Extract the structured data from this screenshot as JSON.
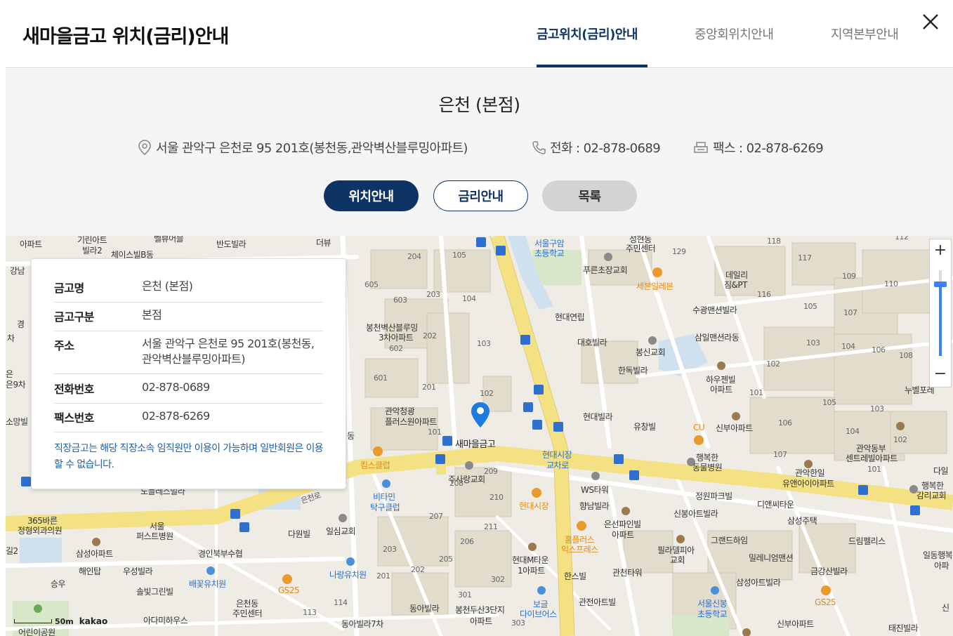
{
  "header": {
    "title": "새마을금고 위치(금리)안내",
    "tabs": [
      {
        "label": "금고위치(금리)안내",
        "active": true
      },
      {
        "label": "중앙회위치안내",
        "active": false
      },
      {
        "label": "지역본부안내",
        "active": false
      }
    ],
    "close_icon": "close-icon"
  },
  "branch": {
    "name": "은천 (본점)",
    "address": "서울 관악구 은천로 95 201호(봉천동,관악벽산블루밍아파트)",
    "phone": "전화 : 02-878-0689",
    "fax": "팩스 : 02-878-6269"
  },
  "buttons": {
    "location": "위치안내",
    "rate": "금리안내",
    "list": "목록"
  },
  "colors": {
    "brand_navy": "#0e3465",
    "note_blue": "#1f5fa8",
    "road_yellow": "#f7e98d",
    "map_bg": "#efece6"
  },
  "info_card": {
    "rows": [
      {
        "key": "금고명",
        "value": "은천 (본점)"
      },
      {
        "key": "금고구분",
        "value": "본점"
      },
      {
        "key": "주소",
        "value": "서울 관악구 은천로 95 201호(봉천동,관악벽산블루밍아파트)"
      },
      {
        "key": "전화번호",
        "value": "02-878-0689"
      },
      {
        "key": "팩스번호",
        "value": "02-878-6269"
      }
    ],
    "note": "직장금고는 해당 직장소속 임직원만 이용이 가능하며 일반회원은 이용 할 수 없습니다."
  },
  "map": {
    "zoom_in": "+",
    "zoom_out": "−",
    "scale": "50m",
    "provider": "kakao",
    "marker_label": "새마을금고",
    "labels": [
      {
        "t": "기린아트",
        "c": ""
      },
      {
        "t": "빌라2",
        "c": ""
      },
      {
        "t": "아파트",
        "c": ""
      },
      {
        "t": "벨뷰어블",
        "c": ""
      },
      {
        "t": "반도빌라",
        "c": ""
      },
      {
        "t": "더뷰",
        "c": ""
      },
      {
        "t": "체이스빌B동",
        "c": ""
      },
      {
        "t": "강남",
        "c": ""
      },
      {
        "t": "경",
        "c": ""
      },
      {
        "t": "차",
        "c": ""
      },
      {
        "t": "은",
        "c": ""
      },
      {
        "t": "은9차",
        "c": ""
      },
      {
        "t": "소망빌",
        "c": ""
      },
      {
        "t": "서울구암",
        "c": "blue"
      },
      {
        "t": "초등학교",
        "c": "blue"
      },
      {
        "t": "성현동",
        "c": ""
      },
      {
        "t": "주민센터",
        "c": ""
      },
      {
        "t": "푸른초장교회",
        "c": ""
      },
      {
        "t": "세븐일레븐",
        "c": "orange"
      },
      {
        "t": "현대연립",
        "c": ""
      },
      {
        "t": "대호빌라",
        "c": ""
      },
      {
        "t": "봉신교회",
        "c": ""
      },
      {
        "t": "한독빌라",
        "c": ""
      },
      {
        "t": "수광맨션빌라",
        "c": ""
      },
      {
        "t": "삼일맨션라동",
        "c": ""
      },
      {
        "t": "하우젠빌",
        "c": ""
      },
      {
        "t": "아파트",
        "c": ""
      },
      {
        "t": "데일리",
        "c": ""
      },
      {
        "t": "짐&PT",
        "c": ""
      },
      {
        "t": "누벨포레",
        "c": ""
      },
      {
        "t": "봉천벽산블루밍",
        "c": ""
      },
      {
        "t": "3차아파트",
        "c": ""
      },
      {
        "t": "관악청광",
        "c": ""
      },
      {
        "t": "플러스원아파트",
        "c": ""
      },
      {
        "t": "현대빌라",
        "c": ""
      },
      {
        "t": "유창빌",
        "c": ""
      },
      {
        "t": "CU",
        "c": "orange"
      },
      {
        "t": "신부아파트",
        "c": ""
      },
      {
        "t": "행복한",
        "c": ""
      },
      {
        "t": "동물병원",
        "c": ""
      },
      {
        "t": "관악동부",
        "c": ""
      },
      {
        "t": "센트레빌아파트",
        "c": ""
      },
      {
        "t": "관악한일",
        "c": ""
      },
      {
        "t": "유앤아이아파트",
        "c": ""
      },
      {
        "t": "다일",
        "c": ""
      },
      {
        "t": "행복한",
        "c": ""
      },
      {
        "t": "감리교회",
        "c": ""
      },
      {
        "t": "현대시장",
        "c": "blue"
      },
      {
        "t": "교차로",
        "c": "blue"
      },
      {
        "t": "WS타워",
        "c": ""
      },
      {
        "t": "킴스클럽",
        "c": "orange"
      },
      {
        "t": "주사랑교회",
        "c": ""
      },
      {
        "t": "비타민",
        "c": "blue"
      },
      {
        "t": "탁구클럽",
        "c": "blue"
      },
      {
        "t": "현대시장",
        "c": "orange"
      },
      {
        "t": "향남빌라",
        "c": ""
      },
      {
        "t": "은선파인빌",
        "c": ""
      },
      {
        "t": "아파트",
        "c": ""
      },
      {
        "t": "정원파크빌",
        "c": ""
      },
      {
        "t": "신봉아트빌라",
        "c": ""
      },
      {
        "t": "디앤씨타운",
        "c": ""
      },
      {
        "t": "삼성주택",
        "c": ""
      },
      {
        "t": "365바른",
        "c": ""
      },
      {
        "t": "정형외과의원",
        "c": ""
      },
      {
        "t": "서울",
        "c": ""
      },
      {
        "t": "퍼스트병원",
        "c": ""
      },
      {
        "t": "다원빌",
        "c": ""
      },
      {
        "t": "일심교회",
        "c": ""
      },
      {
        "t": "홈플러스",
        "c": "orange"
      },
      {
        "t": "익스프레스",
        "c": "orange"
      },
      {
        "t": "필라델피아",
        "c": ""
      },
      {
        "t": "교회",
        "c": ""
      },
      {
        "t": "그랜드하임",
        "c": ""
      },
      {
        "t": "밀레니엄맨션",
        "c": ""
      },
      {
        "t": "드림펠리스",
        "c": ""
      },
      {
        "t": "일동행복",
        "c": ""
      },
      {
        "t": "아파",
        "c": ""
      },
      {
        "t": "길2",
        "c": ""
      },
      {
        "t": "삼성아파트",
        "c": ""
      },
      {
        "t": "경인북부수협",
        "c": ""
      },
      {
        "t": "해인탑",
        "c": ""
      },
      {
        "t": "우성빌라",
        "c": ""
      },
      {
        "t": "현대M타운",
        "c": ""
      },
      {
        "t": "1아파트",
        "c": ""
      },
      {
        "t": "관천타워",
        "c": ""
      },
      {
        "t": "금강산빌라",
        "c": ""
      },
      {
        "t": "승우",
        "c": ""
      },
      {
        "t": "배꽃유치원",
        "c": "blue"
      },
      {
        "t": "나랑유치원",
        "c": "blue"
      },
      {
        "t": "한스빌",
        "c": ""
      },
      {
        "t": "삼성아트빌라",
        "c": ""
      },
      {
        "t": "솔빛그린빌",
        "c": ""
      },
      {
        "t": "GS25",
        "c": "orange"
      },
      {
        "t": "은천동",
        "c": ""
      },
      {
        "t": "주민센터",
        "c": ""
      },
      {
        "t": "동아빌라",
        "c": ""
      },
      {
        "t": "봉천두산3단지",
        "c": ""
      },
      {
        "t": "아파트",
        "c": ""
      },
      {
        "t": "보글",
        "c": "blue"
      },
      {
        "t": "다이브어스",
        "c": "blue"
      },
      {
        "t": "관전아트빌",
        "c": ""
      },
      {
        "t": "서울신봉",
        "c": "blue"
      },
      {
        "t": "초등학교",
        "c": "blue"
      },
      {
        "t": "GS25",
        "c": "orange"
      },
      {
        "t": "신",
        "c": ""
      },
      {
        "t": "아다미하우스",
        "c": ""
      },
      {
        "t": "동아빌라7차",
        "c": ""
      },
      {
        "t": "신부아파트",
        "c": ""
      },
      {
        "t": "태진빌라",
        "c": ""
      },
      {
        "t": "은천로",
        "c": "road"
      },
      {
        "t": "노블레스빌라",
        "c": ""
      },
      {
        "t": "어린이공원",
        "c": ""
      },
      {
        "t": "동",
        "c": ""
      }
    ],
    "numbers": [
      "204",
      "105",
      "605",
      "603",
      "203",
      "104",
      "602",
      "202",
      "103",
      "601",
      "201",
      "102",
      "101",
      "209",
      "208",
      "210",
      "207",
      "211",
      "206",
      "205",
      "203",
      "202",
      "201",
      "302",
      "301",
      "303",
      "114",
      "113",
      "118",
      "117",
      "116",
      "129",
      "109",
      "110",
      "105",
      "107",
      "103",
      "104",
      "106",
      "108",
      "102",
      "101",
      "105",
      "103",
      "106",
      "104",
      "102",
      "107",
      "101",
      "112"
    ]
  }
}
